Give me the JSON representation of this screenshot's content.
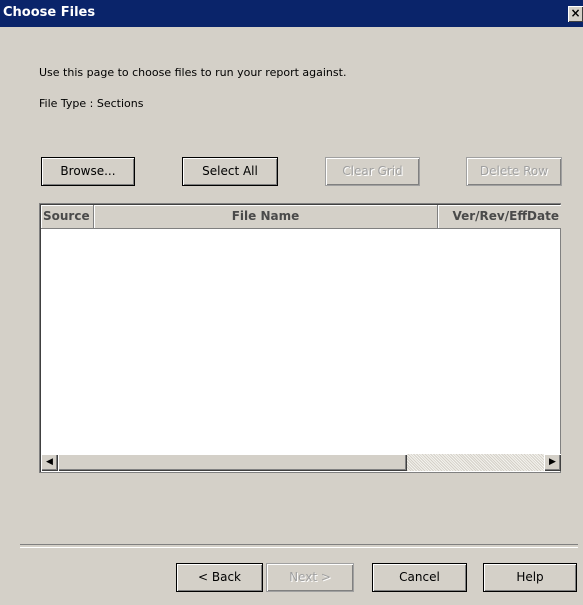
{
  "window": {
    "title": "Choose Files",
    "close_glyph": "×"
  },
  "instructions": "Use this page to choose files to run your report against.",
  "file_type_label": "File Type : Sections",
  "toolbar": {
    "browse": "Browse...",
    "select_all": "Select All",
    "clear_grid": "Clear Grid",
    "delete_row": "Delete Row"
  },
  "grid": {
    "columns": [
      "Source",
      "File Name",
      "Ver/Rev/EffDate"
    ],
    "rows": [],
    "scroll_left_glyph": "◀",
    "scroll_right_glyph": "▶"
  },
  "footer": {
    "back": "< Back",
    "next": "Next >",
    "cancel": "Cancel",
    "help": "Help"
  },
  "colors": {
    "titlebar": "#0a246a",
    "face": "#d4d0c8",
    "disabled_text": "#a0a0a0"
  }
}
